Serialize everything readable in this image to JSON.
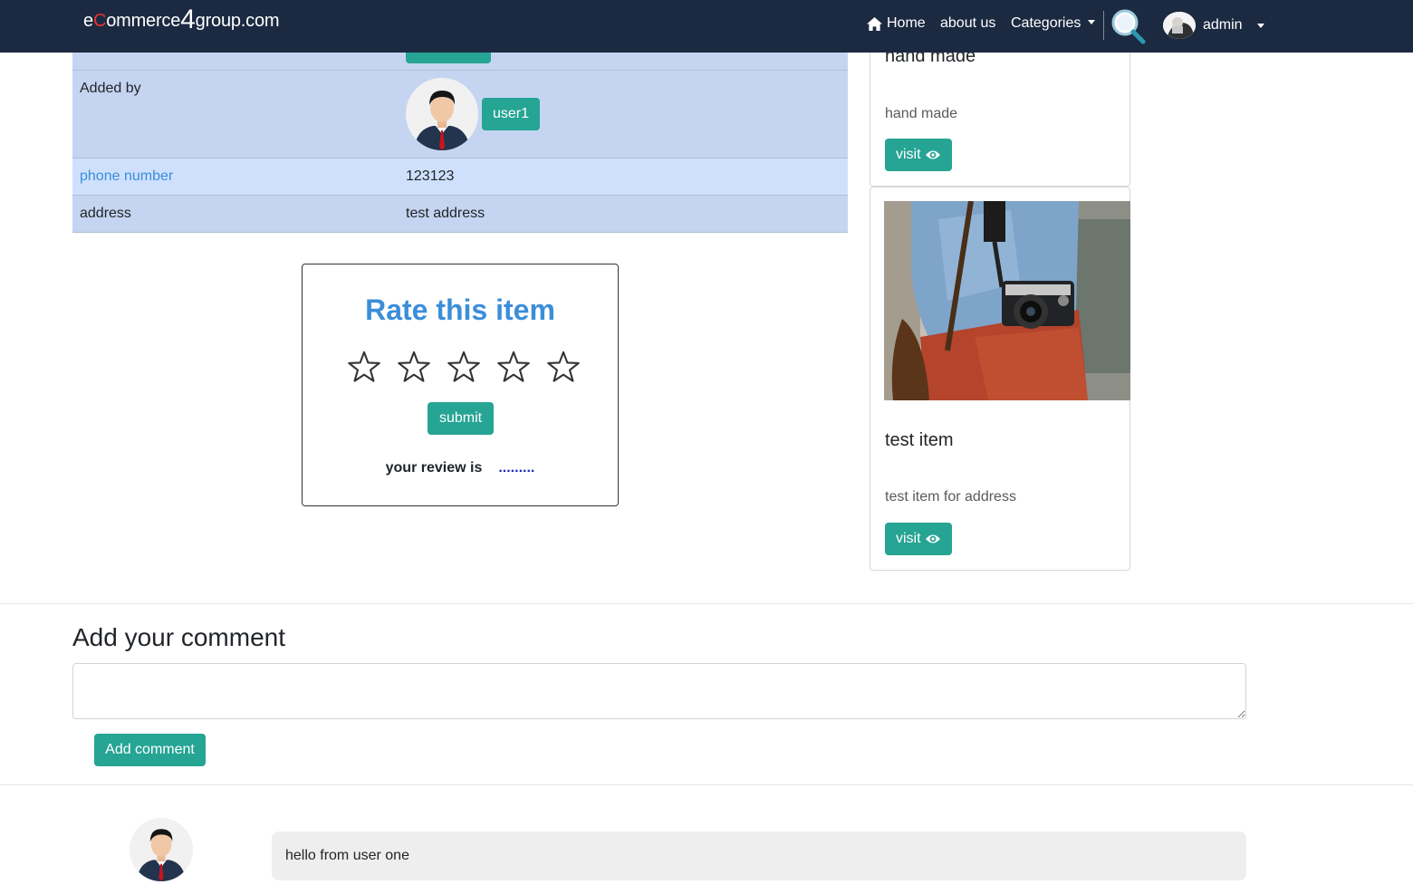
{
  "brand": {
    "part1": "e",
    "part2": "C",
    "part3": "ommerce",
    "part4": "4",
    "part5": "group.com"
  },
  "nav": {
    "home": "Home",
    "about": "about us",
    "categories": "Categories",
    "user": "admin"
  },
  "details": {
    "added_by_label": "Added by",
    "owner_name": "user1",
    "phone_label": "phone number",
    "phone_value": "123123",
    "address_label": "address",
    "address_value": "test address"
  },
  "rating": {
    "title": "Rate this item",
    "stars_total": 5,
    "stars_selected": 0,
    "submit": "submit",
    "review_label": "your review is",
    "review_value": "........."
  },
  "cards": [
    {
      "title": "hand made",
      "text": "hand made",
      "button": "visit"
    },
    {
      "title": "test item",
      "text": "test item for address",
      "button": "visit"
    }
  ],
  "comments": {
    "heading": "Add your comment",
    "input_value": "",
    "add_button": "Add comment",
    "items": [
      {
        "text": "hello from user one"
      }
    ]
  },
  "colors": {
    "navbar": "#1b2a41",
    "accent_button": "#26a494",
    "link_blue": "#3b8ed9",
    "table_row": "#c5d5f1",
    "table_row_alt": "#cfe0fd"
  }
}
